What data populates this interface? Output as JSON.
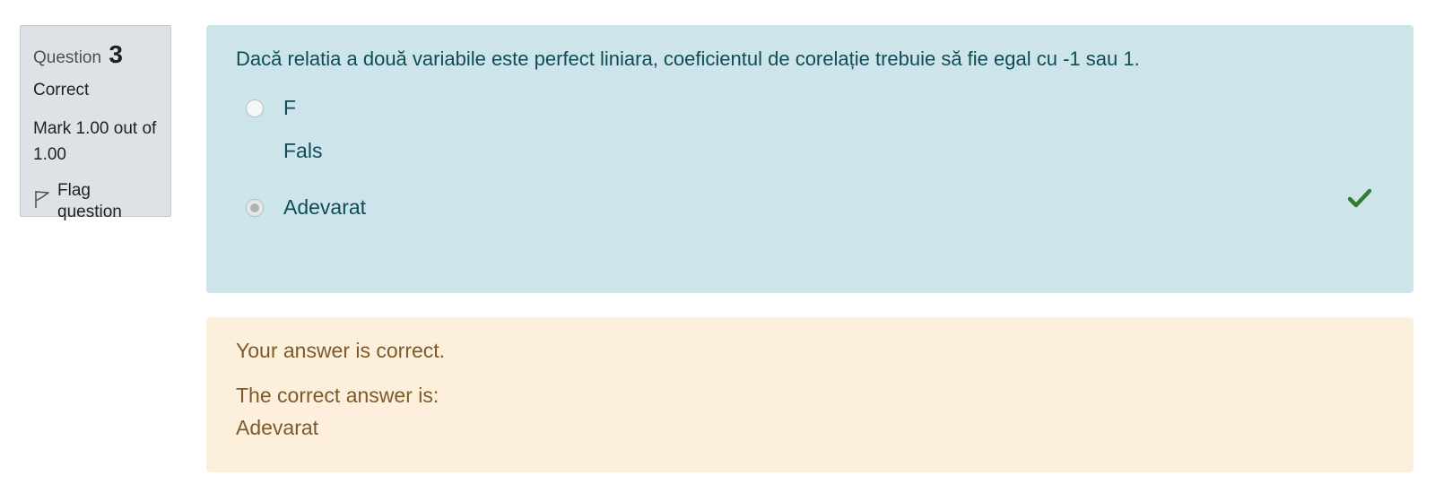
{
  "info": {
    "question_label": "Question",
    "question_number": "3",
    "state": "Correct",
    "grade": "Mark 1.00 out of 1.00",
    "flag_label": "Flag question"
  },
  "question": {
    "text": "Dacă relatia a două variabile este perfect liniara, coeficientul de corelație trebuie să fie egal cu -1 sau 1.",
    "options": [
      {
        "label": "F",
        "sublabel": "Fals",
        "selected": false
      },
      {
        "label": "Adevarat",
        "selected": true,
        "correct": true
      }
    ]
  },
  "feedback": {
    "specific": "Your answer is correct.",
    "right_answer_label": "The correct answer is:",
    "right_answer_value": "Adevarat"
  },
  "colors": {
    "info_bg": "#dee2e6",
    "question_bg": "#cde5ea",
    "feedback_bg": "#fcefdc",
    "tick": "#357a32"
  },
  "icons": {
    "flag": "flag-icon",
    "correct": "check-icon"
  }
}
